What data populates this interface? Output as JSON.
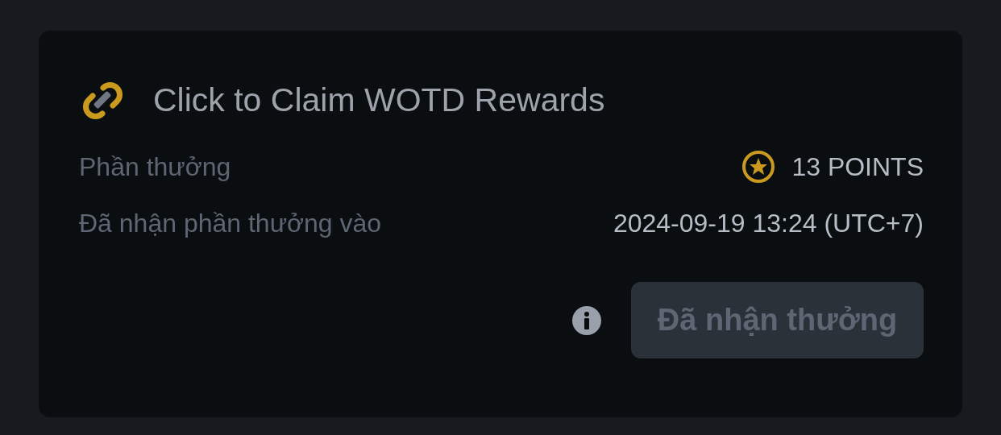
{
  "card": {
    "title": "Click to Claim WOTD Rewards",
    "rows": [
      {
        "kind": "reward",
        "label": "Phần thưởng",
        "value": "13 POINTS"
      },
      {
        "kind": "plain",
        "label": "Đã nhận phần thưởng vào",
        "value": "2024-09-19 13:24 (UTC+7)"
      }
    ],
    "button": {
      "label": "Đã nhận thưởng",
      "disabled": true
    }
  }
}
